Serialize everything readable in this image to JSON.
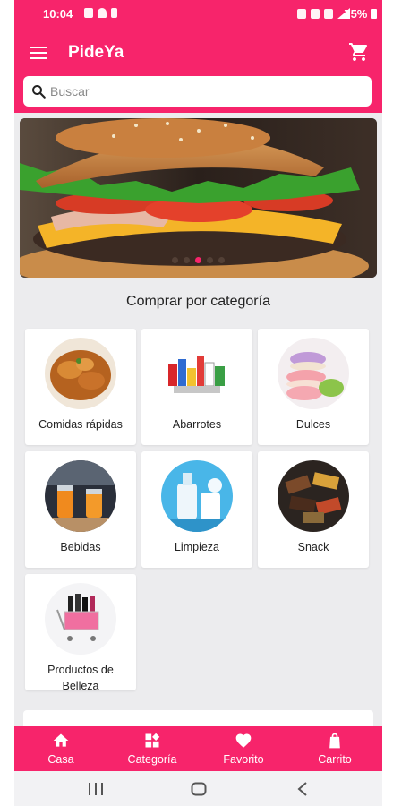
{
  "status_bar": {
    "time": "10:04",
    "battery": "75%"
  },
  "app_bar": {
    "title": "PideYa"
  },
  "search": {
    "placeholder": "Buscar",
    "value": ""
  },
  "carousel": {
    "slides": 5,
    "active_index": 2
  },
  "section": {
    "title": "Comprar por categoría"
  },
  "categories": [
    {
      "label": "Comidas rápidas"
    },
    {
      "label": "Abarrotes"
    },
    {
      "label": "Dulces"
    },
    {
      "label": "Bebidas"
    },
    {
      "label": "Limpieza"
    },
    {
      "label": "Snack"
    },
    {
      "label": "Productos de Belleza"
    }
  ],
  "bottom_nav": {
    "items": [
      {
        "label": "Casa",
        "icon": "home-icon"
      },
      {
        "label": "Categoría",
        "icon": "category-icon"
      },
      {
        "label": "Favorito",
        "icon": "heart-icon"
      },
      {
        "label": "Carrito",
        "icon": "bag-icon"
      }
    ]
  },
  "colors": {
    "primary": "#f7246b",
    "background": "#ececee",
    "card": "#ffffff"
  }
}
